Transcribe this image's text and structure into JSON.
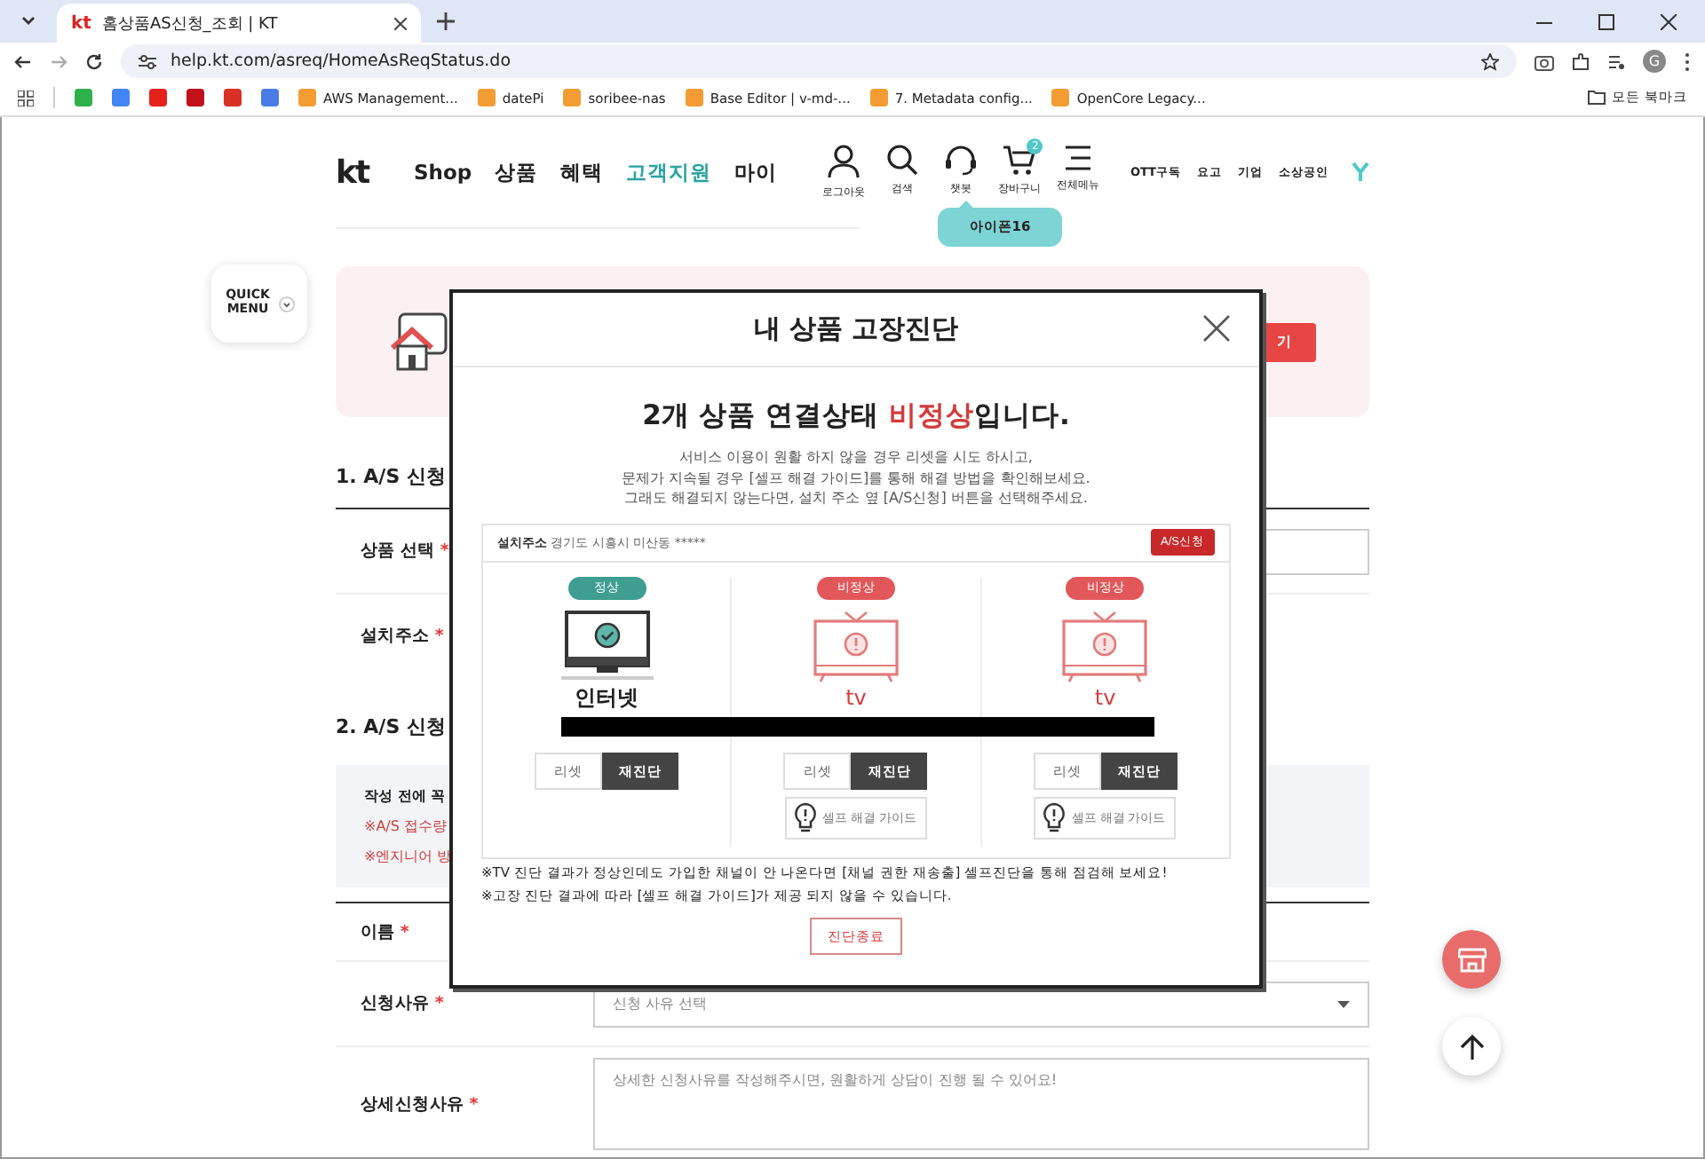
{
  "browser": {
    "tabs": [
      {
        "favicon": "kt",
        "title": "홈상품AS신청_조회 | KT",
        "selected": true
      }
    ],
    "url": "help.kt.com/asreq/HomeAsReqStatus.do",
    "profile": "G",
    "bookmarks": [
      {
        "label": "AWS Management..."
      },
      {
        "label": "datePi"
      },
      {
        "label": "soribee-nas"
      },
      {
        "label": "Base Editor | v-md-..."
      },
      {
        "label": "7. Metadata config..."
      },
      {
        "label": "OpenCore Legacy..."
      }
    ],
    "all_bookmarks": "모든 북마크"
  },
  "header": {
    "logo": "kt",
    "nav": [
      {
        "label": "Shop",
        "selected": false
      },
      {
        "label": "상품",
        "selected": false
      },
      {
        "label": "혜택",
        "selected": false
      },
      {
        "label": "고객지원",
        "selected": true
      },
      {
        "label": "마이",
        "selected": false
      }
    ],
    "tools": [
      {
        "kind": "person",
        "label": "로그아웃"
      },
      {
        "kind": "search",
        "label": "검색"
      },
      {
        "kind": "headset",
        "label": "챗봇"
      },
      {
        "kind": "cart",
        "label": "장바구니",
        "badge": "2"
      },
      {
        "kind": "menu",
        "label": "전체메뉴"
      }
    ],
    "links": [
      "OTT구독",
      "요고",
      "기업",
      "소상공인"
    ],
    "tooltip": "아이폰16"
  },
  "quick_menu": "QUICK MENU",
  "banner": {
    "button": "기"
  },
  "section1": {
    "title": "1. A/S 신청",
    "rows": [
      {
        "label": "상품 선택",
        "mark": "*"
      },
      {
        "label": "설치주소",
        "mark": "*"
      }
    ]
  },
  "section2": {
    "title": "2. A/S 신청",
    "notice": {
      "title": "작성 전에 꼭",
      "lines": [
        "※A/S 접수량",
        "※엔지니어 방"
      ]
    },
    "rows": [
      {
        "label": "이름",
        "mark": "*",
        "kind": "none"
      },
      {
        "label": "신청사유",
        "mark": "*",
        "kind": "select",
        "value": "신청 사유 선택"
      },
      {
        "label": "상세신청사유",
        "mark": "*",
        "kind": "textarea",
        "placeholder": "상세한 신청사유를 작성해주시면, 원활하게 상담이 진행 될 수 있어요!"
      }
    ]
  },
  "modal": {
    "title": "내 상품 고장진단",
    "heading_before": "2개 상품 연결상태 ",
    "heading_highlight": "비정상",
    "heading_after": "입니다.",
    "description": [
      "서비스 이용이 원활 하지 않을 경우 리셋을 시도 하시고,",
      "문제가 지속될 경우 [셀프 해결 가이드]를 통해 해결 방법을 확인해보세요.",
      "그래도 해결되지 않는다면, 설치 주소 옆 [A/S신청] 버튼을 선택해주세요."
    ],
    "address_label": "설치주소",
    "address": "경기도 시흥시 미산동 *****",
    "as_button": "A/S신청",
    "products": [
      {
        "status": "정상",
        "kind": "normal",
        "name": "인터넷",
        "reset": "리셋",
        "recheck": "재진단"
      },
      {
        "status": "비정상",
        "kind": "abnormal",
        "name": "tv",
        "reset": "리셋",
        "recheck": "재진단",
        "guide": "셀프 해결 가이드"
      },
      {
        "status": "비정상",
        "kind": "abnormal",
        "name": "tv",
        "reset": "리셋",
        "recheck": "재진단",
        "guide": "셀프 해결 가이드"
      }
    ],
    "notes": [
      "※TV 진단 결과가 정상인데도 가입한 채널이 안 나온다면 [채널 권한 재송출] 셀프진단을 통해 점검해 보세요!",
      "※고장 진단 결과에 따라 [셀프 해결 가이드]가 제공 되지 않을 수 있습니다."
    ],
    "close_button": "진단종료"
  }
}
